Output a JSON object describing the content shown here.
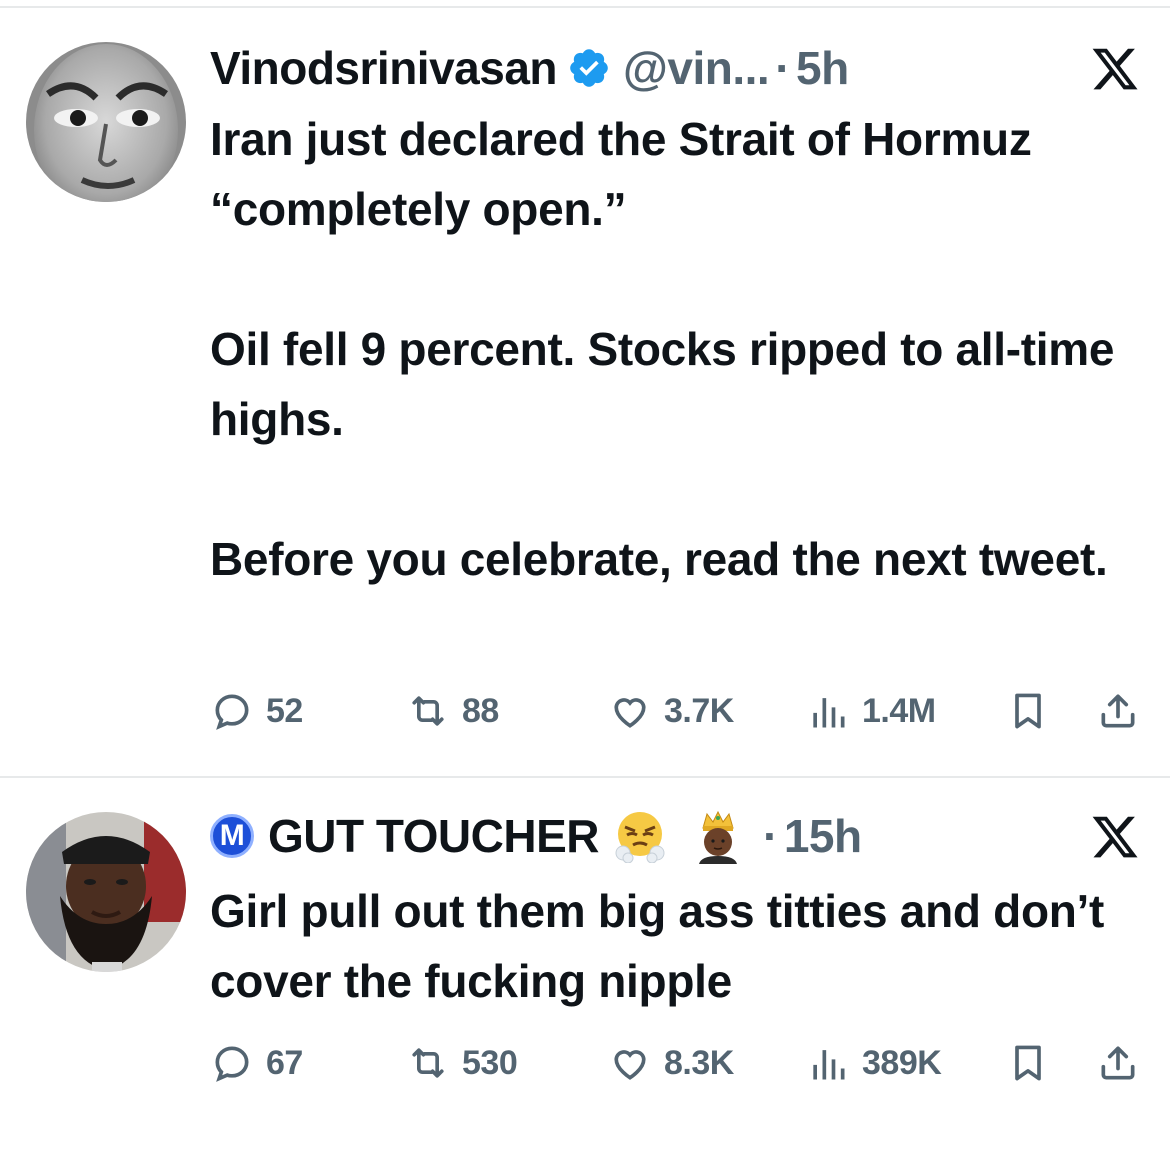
{
  "colors": {
    "text": "#0f1419",
    "secondary": "#536471",
    "verified": "#1d9bf0",
    "divider": "#e7e9ea"
  },
  "tweets": [
    {
      "display_name": "Vinodsrinivasan",
      "verified_icon": "verified-badge-icon",
      "handle": "@vin...",
      "separator": "·",
      "time": "5h",
      "body": [
        "Iran just declared the Strait of Hormuz “completely open.”",
        "Oil fell 9 percent. Stocks ripped to all-time highs.",
        "Before you celebrate, read the next tweet."
      ],
      "replies": "52",
      "reposts": "88",
      "likes": "3.7K",
      "views": "1.4M"
    },
    {
      "badge": "M",
      "display_name": "GUT TOUCHER",
      "emoji_1": "face-with-steam-emoji",
      "emoji_2": "person-with-crown-emoji",
      "separator": "·",
      "time": "15h",
      "body": [
        "Girl pull out them big ass titties and don’t cover the fucking nipple"
      ],
      "replies": "67",
      "reposts": "530",
      "likes": "8.3K",
      "views": "389K"
    }
  ]
}
